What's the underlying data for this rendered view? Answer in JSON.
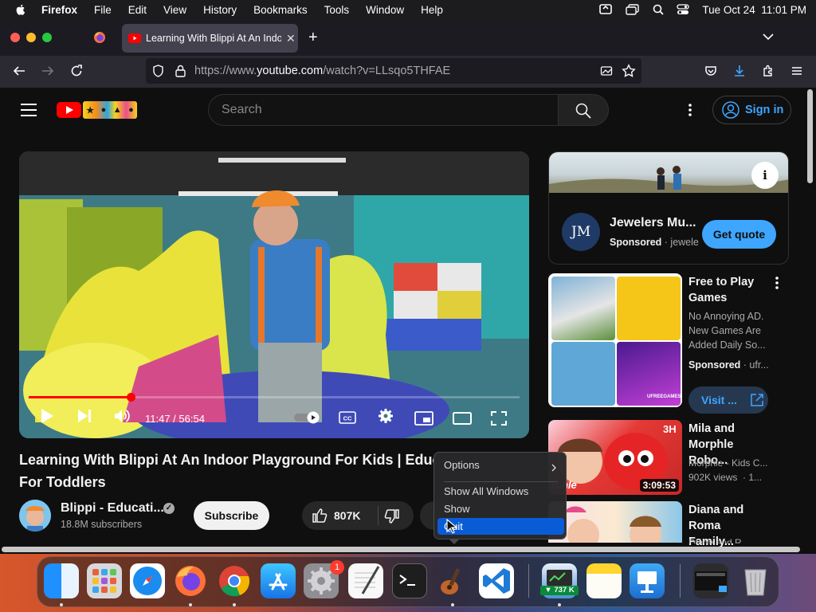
{
  "menubar": {
    "app": "Firefox",
    "items": [
      "File",
      "Edit",
      "View",
      "History",
      "Bookmarks",
      "Tools",
      "Window",
      "Help"
    ],
    "clock": "Tue Oct 24  11:01 PM"
  },
  "browser": {
    "tab_title": "Learning With Blippi At An Indoor Playground For Kids | Educational Videos For Toddlers",
    "url_prefix": "https://www.",
    "url_host": "youtube.com",
    "url_path": "/watch?v=LLsqo5THFAE"
  },
  "youtube": {
    "search_placeholder": "Search",
    "sign_in": "Sign in",
    "player": {
      "time": "11:47 / 56:54",
      "progress_fraction": 0.207
    },
    "video": {
      "title_line1": "Learning With Blippi At An Indoor Playground For Kids | Educ",
      "title_line2": "For Toddlers",
      "channel": "Blippi - Educati...",
      "subscribers": "18.8M subscribers",
      "subscribe": "Subscribe",
      "likes": "807K"
    },
    "ad": {
      "title": "Jewelers Mu...",
      "sponsored": "Sponsored",
      "advertiser": "· jewele",
      "logo_text": "JM",
      "cta": "Get quote"
    },
    "promo": {
      "title_line1": "Free to Play",
      "title_line2": "Games",
      "desc": "No Annoying AD. New Games Are Added Daily So...",
      "sponsored": "Sponsored",
      "advertiser": "· ufr...",
      "cta": "Visit ...",
      "thumb_brand": "UFREEGAMES"
    },
    "related": [
      {
        "title_line1": "Mila and",
        "title_line2": "Morphle Robo...",
        "channel": "Morphle - Kids C...",
        "meta": "902K views  · 1...",
        "duration": "3:09:53",
        "thumb_tag": "3H",
        "thumb_brand": "rphle"
      },
      {
        "title_line1": "Diana and",
        "title_line2": "Roma Family...",
        "channel": "Diana and R...",
        "meta": "",
        "duration": ""
      }
    ]
  },
  "context_menu": {
    "options": "Options",
    "show_all": "Show All Windows",
    "show": "Show",
    "quit": "Quit"
  },
  "dock": {
    "settings_badge": "1",
    "net_badge": "▼ 737 K"
  },
  "colors": {
    "yt_red": "#ff0000",
    "yt_blue": "#3ea6ff",
    "menu_highlight": "#0a5cd6"
  }
}
